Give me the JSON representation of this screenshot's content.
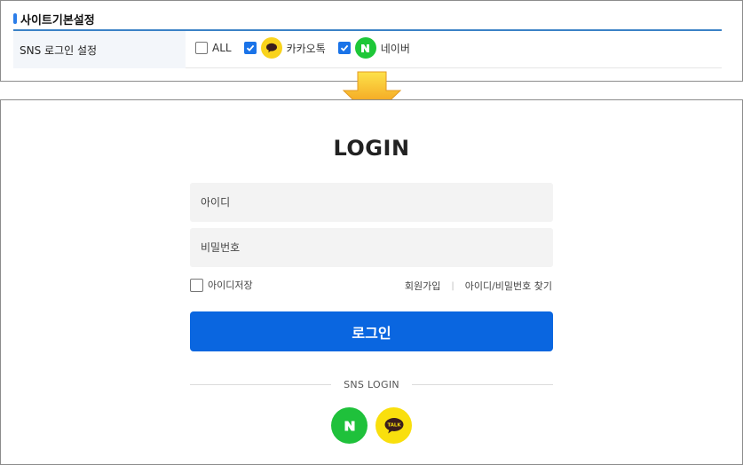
{
  "settings": {
    "section_title": "사이트기본설정",
    "row_label": "SNS 로그인 설정",
    "options": [
      {
        "label": "ALL",
        "checked": false,
        "icon": "none"
      },
      {
        "label": "카카오톡",
        "checked": true,
        "icon": "kakao-talk-icon"
      },
      {
        "label": "네이버",
        "checked": true,
        "icon": "naver-icon"
      }
    ]
  },
  "arrow": {
    "icon": "down-arrow-icon",
    "color": "#f7a21b"
  },
  "login": {
    "title": "LOGIN",
    "id_placeholder": "아이디",
    "password_placeholder": "비밀번호",
    "remember_label": "아이디저장",
    "signup_link": "회원가입",
    "separator": "|",
    "find_link": "아이디/비밀번호 찾기",
    "login_button": "로그인",
    "sns_label": "SNS LOGIN",
    "naver_glyph": "N",
    "kakao_glyph": "TALK"
  },
  "colors": {
    "accent": "#0a66e0",
    "naver": "#1fc13b",
    "kakao": "#f9df0d",
    "title_rule": "#3b82c6"
  }
}
